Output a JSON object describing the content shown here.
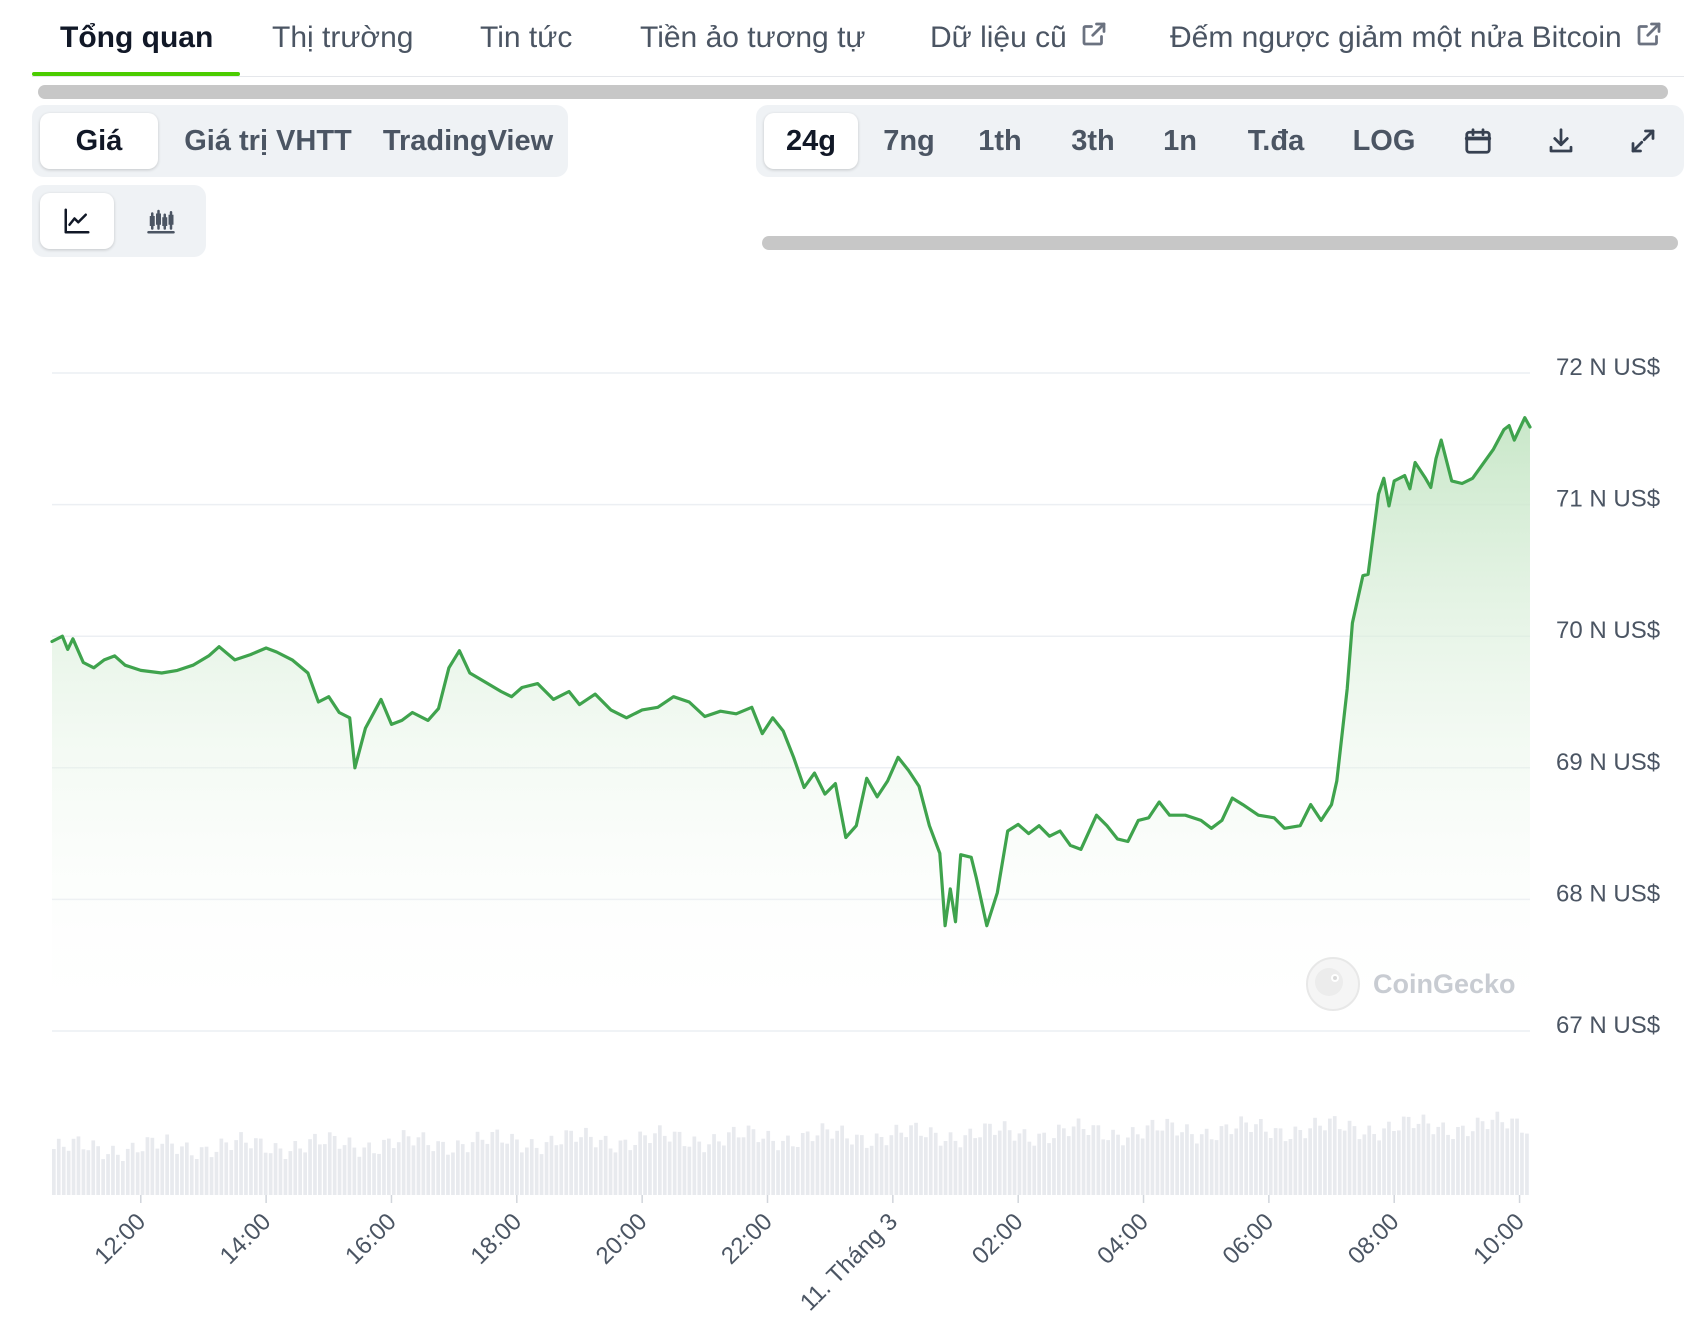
{
  "tabs": [
    {
      "label": "Tổng quan",
      "active": true
    },
    {
      "label": "Thị trường",
      "active": false
    },
    {
      "label": "Tin tức",
      "active": false
    },
    {
      "label": "Tiền ảo tương tự",
      "active": false
    },
    {
      "label": "Dữ liệu cũ",
      "active": false,
      "external": true
    },
    {
      "label": "Đếm ngược giảm một nửa Bitcoin",
      "active": false,
      "external": true
    }
  ],
  "chart_type_tabs": {
    "price": "Giá",
    "market_cap": "Giá trị VHTT",
    "tradingview": "TradingView"
  },
  "range_tabs": {
    "d24": "24g",
    "d7": "7ng",
    "m1": "1th",
    "m3": "3th",
    "y1": "1n",
    "max": "T.đa",
    "log": "LOG"
  },
  "icons": {
    "line_chart": "line-chart-icon",
    "candlestick": "candlestick-icon",
    "calendar": "calendar-icon",
    "download": "download-icon",
    "expand": "expand-icon",
    "external_link": "external-link-icon"
  },
  "watermark": "CoinGecko",
  "colors": {
    "accent": "#4bcc00",
    "line": "#3fa34d",
    "fill": "#d4ecd4",
    "volume": "#e5e7eb"
  },
  "chart_data": {
    "type": "area",
    "title": "",
    "xlabel": "",
    "ylabel": "",
    "y_unit": "N US$",
    "ylim": [
      67000,
      72000
    ],
    "yticks": [
      72000,
      71000,
      70000,
      69000,
      68000,
      67000
    ],
    "ytick_labels": [
      "72 N US$",
      "71 N US$",
      "70 N US$",
      "69 N US$",
      "68 N US$",
      "67 N US$"
    ],
    "x_range": [
      "10/03 10:35",
      "11/03 10:10"
    ],
    "xticks": [
      "10/03 12:00",
      "10/03 14:00",
      "10/03 16:00",
      "10/03 18:00",
      "10/03 20:00",
      "10/03 22:00",
      "11/03 00:00",
      "11/03 02:00",
      "11/03 04:00",
      "11/03 06:00",
      "11/03 08:00",
      "11/03 10:00"
    ],
    "xtick_labels": [
      "12:00",
      "14:00",
      "16:00",
      "18:00",
      "20:00",
      "22:00",
      "11. Tháng 3",
      "02:00",
      "04:00",
      "06:00",
      "08:00",
      "10:00"
    ],
    "grid": true,
    "series": [
      {
        "points": [
          [
            "10/03 10:35",
            69960
          ],
          [
            "10/03 10:45",
            70000
          ],
          [
            "10/03 10:50",
            69900
          ],
          [
            "10/03 10:55",
            69980
          ],
          [
            "10/03 11:05",
            69800
          ],
          [
            "10/03 11:15",
            69760
          ],
          [
            "10/03 11:25",
            69820
          ],
          [
            "10/03 11:35",
            69850
          ],
          [
            "10/03 11:45",
            69780
          ],
          [
            "10/03 12:00",
            69740
          ],
          [
            "10/03 12:20",
            69720
          ],
          [
            "10/03 12:35",
            69740
          ],
          [
            "10/03 12:50",
            69780
          ],
          [
            "10/03 13:05",
            69850
          ],
          [
            "10/03 13:15",
            69920
          ],
          [
            "10/03 13:30",
            69820
          ],
          [
            "10/03 13:45",
            69860
          ],
          [
            "10/03 14:00",
            69910
          ],
          [
            "10/03 14:10",
            69880
          ],
          [
            "10/03 14:25",
            69820
          ],
          [
            "10/03 14:40",
            69720
          ],
          [
            "10/03 14:50",
            69500
          ],
          [
            "10/03 15:00",
            69540
          ],
          [
            "10/03 15:10",
            69420
          ],
          [
            "10/03 15:20",
            69380
          ],
          [
            "10/03 15:25",
            69000
          ],
          [
            "10/03 15:35",
            69300
          ],
          [
            "10/03 15:50",
            69520
          ],
          [
            "10/03 16:00",
            69330
          ],
          [
            "10/03 16:10",
            69360
          ],
          [
            "10/03 16:20",
            69420
          ],
          [
            "10/03 16:35",
            69360
          ],
          [
            "10/03 16:45",
            69450
          ],
          [
            "10/03 16:55",
            69760
          ],
          [
            "10/03 17:05",
            69890
          ],
          [
            "10/03 17:15",
            69720
          ],
          [
            "10/03 17:30",
            69650
          ],
          [
            "10/03 17:45",
            69580
          ],
          [
            "10/03 17:55",
            69540
          ],
          [
            "10/03 18:05",
            69610
          ],
          [
            "10/03 18:20",
            69640
          ],
          [
            "10/03 18:35",
            69520
          ],
          [
            "10/03 18:50",
            69580
          ],
          [
            "10/03 19:00",
            69480
          ],
          [
            "10/03 19:15",
            69560
          ],
          [
            "10/03 19:30",
            69440
          ],
          [
            "10/03 19:45",
            69380
          ],
          [
            "10/03 20:00",
            69440
          ],
          [
            "10/03 20:15",
            69460
          ],
          [
            "10/03 20:30",
            69540
          ],
          [
            "10/03 20:45",
            69500
          ],
          [
            "10/03 21:00",
            69390
          ],
          [
            "10/03 21:15",
            69430
          ],
          [
            "10/03 21:30",
            69410
          ],
          [
            "10/03 21:45",
            69460
          ],
          [
            "10/03 21:55",
            69260
          ],
          [
            "10/03 22:05",
            69380
          ],
          [
            "10/03 22:15",
            69280
          ],
          [
            "10/03 22:25",
            69080
          ],
          [
            "10/03 22:35",
            68850
          ],
          [
            "10/03 22:45",
            68960
          ],
          [
            "10/03 22:55",
            68800
          ],
          [
            "10/03 23:05",
            68880
          ],
          [
            "10/03 23:15",
            68470
          ],
          [
            "10/03 23:25",
            68560
          ],
          [
            "10/03 23:35",
            68920
          ],
          [
            "10/03 23:45",
            68780
          ],
          [
            "10/03 23:55",
            68900
          ],
          [
            "11/03 00:05",
            69080
          ],
          [
            "11/03 00:15",
            68980
          ],
          [
            "11/03 00:25",
            68860
          ],
          [
            "11/03 00:35",
            68560
          ],
          [
            "11/03 00:45",
            68350
          ],
          [
            "11/03 00:50",
            67800
          ],
          [
            "11/03 00:55",
            68080
          ],
          [
            "11/03 01:00",
            67830
          ],
          [
            "11/03 01:05",
            68340
          ],
          [
            "11/03 01:15",
            68320
          ],
          [
            "11/03 01:20",
            68160
          ],
          [
            "11/03 01:30",
            67800
          ],
          [
            "11/03 01:40",
            68050
          ],
          [
            "11/03 01:50",
            68520
          ],
          [
            "11/03 02:00",
            68570
          ],
          [
            "11/03 02:10",
            68500
          ],
          [
            "11/03 02:20",
            68560
          ],
          [
            "11/03 02:30",
            68480
          ],
          [
            "11/03 02:40",
            68520
          ],
          [
            "11/03 02:50",
            68410
          ],
          [
            "11/03 03:00",
            68380
          ],
          [
            "11/03 03:15",
            68640
          ],
          [
            "11/03 03:25",
            68560
          ],
          [
            "11/03 03:35",
            68460
          ],
          [
            "11/03 03:45",
            68440
          ],
          [
            "11/03 03:55",
            68600
          ],
          [
            "11/03 04:05",
            68620
          ],
          [
            "11/03 04:15",
            68740
          ],
          [
            "11/03 04:25",
            68640
          ],
          [
            "11/03 04:40",
            68640
          ],
          [
            "11/03 04:55",
            68600
          ],
          [
            "11/03 05:05",
            68540
          ],
          [
            "11/03 05:15",
            68600
          ],
          [
            "11/03 05:25",
            68770
          ],
          [
            "11/03 05:35",
            68720
          ],
          [
            "11/03 05:50",
            68640
          ],
          [
            "11/03 06:05",
            68620
          ],
          [
            "11/03 06:15",
            68540
          ],
          [
            "11/03 06:30",
            68560
          ],
          [
            "11/03 06:40",
            68720
          ],
          [
            "11/03 06:50",
            68600
          ],
          [
            "11/03 07:00",
            68720
          ],
          [
            "11/03 07:05",
            68900
          ],
          [
            "11/03 07:15",
            69600
          ],
          [
            "11/03 07:20",
            70100
          ],
          [
            "11/03 07:30",
            70460
          ],
          [
            "11/03 07:35",
            70470
          ],
          [
            "11/03 07:45",
            71080
          ],
          [
            "11/03 07:50",
            71200
          ],
          [
            "11/03 07:55",
            70990
          ],
          [
            "11/03 08:00",
            71180
          ],
          [
            "11/03 08:10",
            71220
          ],
          [
            "11/03 08:15",
            71120
          ],
          [
            "11/03 08:20",
            71320
          ],
          [
            "11/03 08:30",
            71200
          ],
          [
            "11/03 08:35",
            71130
          ],
          [
            "11/03 08:40",
            71350
          ],
          [
            "11/03 08:45",
            71490
          ],
          [
            "11/03 08:55",
            71180
          ],
          [
            "11/03 09:05",
            71160
          ],
          [
            "11/03 09:15",
            71200
          ],
          [
            "11/03 09:25",
            71310
          ],
          [
            "11/03 09:35",
            71420
          ],
          [
            "11/03 09:45",
            71570
          ],
          [
            "11/03 09:50",
            71600
          ],
          [
            "11/03 09:55",
            71490
          ],
          [
            "11/03 10:05",
            71660
          ],
          [
            "11/03 10:10",
            71590
          ]
        ]
      }
    ]
  }
}
